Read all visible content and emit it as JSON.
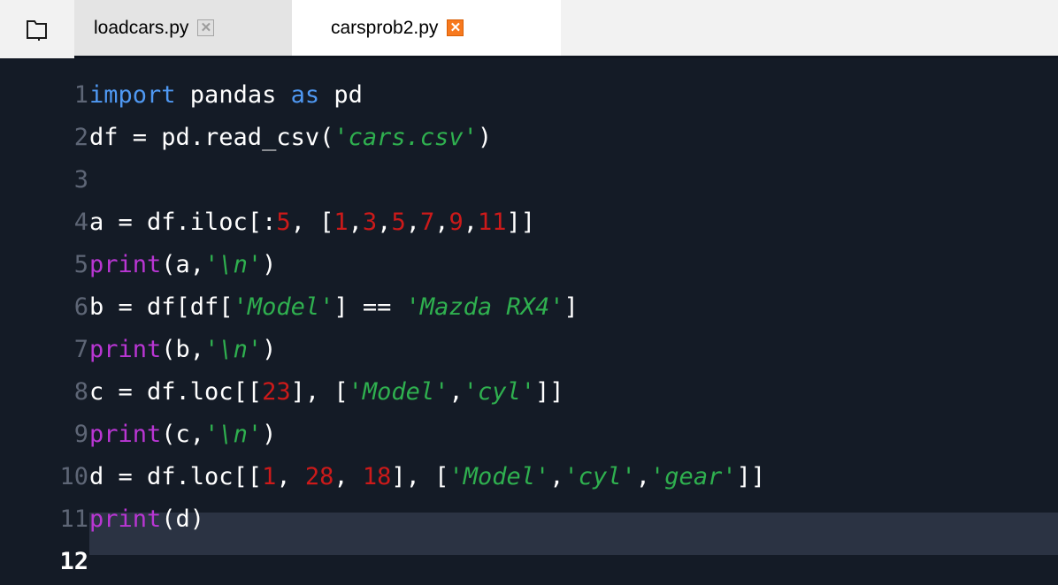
{
  "tabs": [
    {
      "label": "loadcars.py",
      "active": false,
      "close_glyph": "✕"
    },
    {
      "label": "carsprob2.py",
      "active": true,
      "close_glyph": "✕"
    }
  ],
  "icons": {
    "folder": "folder-icon",
    "close": "close-icon"
  },
  "colors": {
    "editor_bg": "#141b26",
    "current_line_bg": "#2b3343",
    "keyword": "#4f98f2",
    "builtin": "#b936d3",
    "string": "#2fb04f",
    "number": "#cc1a1a",
    "active_close": "#f7791e"
  },
  "editor": {
    "current_line": 12,
    "lines": [
      {
        "no": "1",
        "tokens": [
          {
            "t": "import",
            "c": "kw"
          },
          {
            "t": " pandas ",
            "c": ""
          },
          {
            "t": "as",
            "c": "kw"
          },
          {
            "t": " pd",
            "c": ""
          }
        ]
      },
      {
        "no": "2",
        "tokens": [
          {
            "t": "df = pd.read_csv(",
            "c": ""
          },
          {
            "t": "'cars.csv'",
            "c": "str"
          },
          {
            "t": ")",
            "c": ""
          }
        ]
      },
      {
        "no": "3",
        "tokens": []
      },
      {
        "no": "4",
        "tokens": [
          {
            "t": "a = df.iloc[:",
            "c": ""
          },
          {
            "t": "5",
            "c": "num"
          },
          {
            "t": ", [",
            "c": ""
          },
          {
            "t": "1",
            "c": "num"
          },
          {
            "t": ",",
            "c": ""
          },
          {
            "t": "3",
            "c": "num"
          },
          {
            "t": ",",
            "c": ""
          },
          {
            "t": "5",
            "c": "num"
          },
          {
            "t": ",",
            "c": ""
          },
          {
            "t": "7",
            "c": "num"
          },
          {
            "t": ",",
            "c": ""
          },
          {
            "t": "9",
            "c": "num"
          },
          {
            "t": ",",
            "c": ""
          },
          {
            "t": "11",
            "c": "num"
          },
          {
            "t": "]]",
            "c": ""
          }
        ]
      },
      {
        "no": "5",
        "tokens": [
          {
            "t": "print",
            "c": "fn"
          },
          {
            "t": "(a,",
            "c": ""
          },
          {
            "t": "'\\n'",
            "c": "str"
          },
          {
            "t": ")",
            "c": ""
          }
        ]
      },
      {
        "no": "6",
        "tokens": [
          {
            "t": "b = df[df[",
            "c": ""
          },
          {
            "t": "'Model'",
            "c": "str"
          },
          {
            "t": "] == ",
            "c": ""
          },
          {
            "t": "'Mazda RX4'",
            "c": "str"
          },
          {
            "t": "]",
            "c": ""
          }
        ]
      },
      {
        "no": "7",
        "tokens": [
          {
            "t": "print",
            "c": "fn"
          },
          {
            "t": "(b,",
            "c": ""
          },
          {
            "t": "'\\n'",
            "c": "str"
          },
          {
            "t": ")",
            "c": ""
          }
        ]
      },
      {
        "no": "8",
        "tokens": [
          {
            "t": "c = df.loc[[",
            "c": ""
          },
          {
            "t": "23",
            "c": "num"
          },
          {
            "t": "], [",
            "c": ""
          },
          {
            "t": "'Model'",
            "c": "str"
          },
          {
            "t": ",",
            "c": ""
          },
          {
            "t": "'cyl'",
            "c": "str"
          },
          {
            "t": "]]",
            "c": ""
          }
        ]
      },
      {
        "no": "9",
        "tokens": [
          {
            "t": "print",
            "c": "fn"
          },
          {
            "t": "(c,",
            "c": ""
          },
          {
            "t": "'\\n'",
            "c": "str"
          },
          {
            "t": ")",
            "c": ""
          }
        ]
      },
      {
        "no": "10",
        "tokens": [
          {
            "t": "d = df.loc[[",
            "c": ""
          },
          {
            "t": "1",
            "c": "num"
          },
          {
            "t": ", ",
            "c": ""
          },
          {
            "t": "28",
            "c": "num"
          },
          {
            "t": ", ",
            "c": ""
          },
          {
            "t": "18",
            "c": "num"
          },
          {
            "t": "], [",
            "c": ""
          },
          {
            "t": "'Model'",
            "c": "str"
          },
          {
            "t": ",",
            "c": ""
          },
          {
            "t": "'cyl'",
            "c": "str"
          },
          {
            "t": ",",
            "c": ""
          },
          {
            "t": "'gear'",
            "c": "str"
          },
          {
            "t": "]]",
            "c": ""
          }
        ]
      },
      {
        "no": "11",
        "tokens": [
          {
            "t": "print",
            "c": "fn"
          },
          {
            "t": "(d)",
            "c": ""
          }
        ]
      },
      {
        "no": "12",
        "tokens": []
      }
    ]
  }
}
